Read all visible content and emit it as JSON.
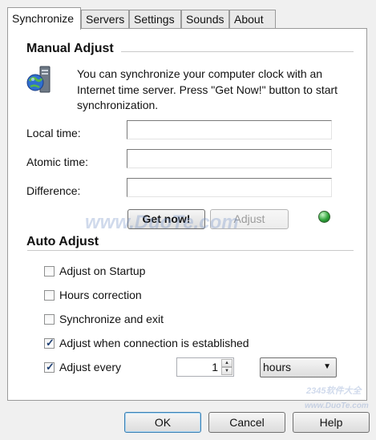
{
  "tabs": [
    {
      "label": "Synchronize",
      "active": true
    },
    {
      "label": "Servers",
      "active": false
    },
    {
      "label": "Settings",
      "active": false
    },
    {
      "label": "Sounds",
      "active": false
    },
    {
      "label": "About",
      "active": false
    }
  ],
  "manual": {
    "title": "Manual Adjust",
    "description": "You can synchronize your computer clock with an Internet time server. Press \"Get Now!\" button to start synchronization.",
    "local_time_label": "Local time:",
    "local_time_value": "",
    "atomic_time_label": "Atomic time:",
    "atomic_time_value": "",
    "difference_label": "Difference:",
    "difference_value": "",
    "get_now_label": "Get now!",
    "adjust_label": "Adjust",
    "status_color": "#2fa33a"
  },
  "auto": {
    "title": "Auto Adjust",
    "options": [
      {
        "label": "Adjust on Startup",
        "checked": false
      },
      {
        "label": "Hours correction",
        "checked": false
      },
      {
        "label": "Synchronize and exit",
        "checked": false
      },
      {
        "label": "Adjust when connection is established",
        "checked": true
      },
      {
        "label": "Adjust every",
        "checked": true
      }
    ],
    "interval_value": "1",
    "interval_unit": "hours"
  },
  "footer": {
    "ok_label": "OK",
    "cancel_label": "Cancel",
    "help_label": "Help"
  },
  "watermarks": {
    "center": "www.DuoTe.com",
    "corner_brand": "2345软件大全",
    "corner_url": "www.DuoTe.com"
  }
}
